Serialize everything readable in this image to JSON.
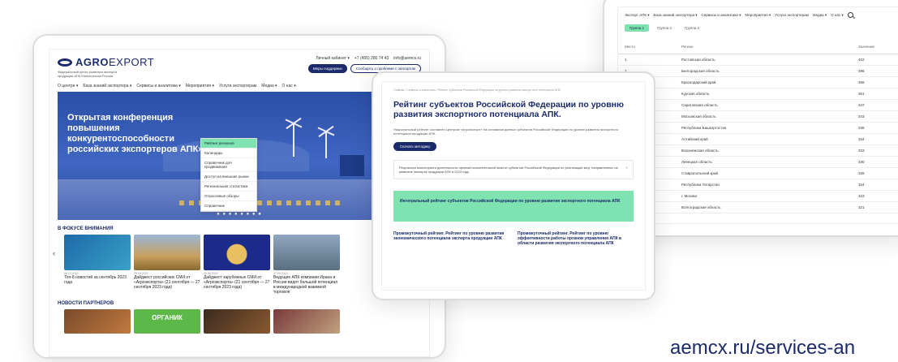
{
  "left_site": {
    "logo_bold": "AGRO",
    "logo_light": "EXPORT",
    "logo_subtitle": "Федеральный центр развития экспорта продукции АПК Минсельхоза России",
    "contacts": [
      "Личный кабинет ▾",
      "+7 (495) 280 74 43",
      "info@aemcx.ru"
    ],
    "btn_primary": "Меры поддержки",
    "btn_secondary": "Сообщить о проблеме с экспортом",
    "nav": [
      "О центре ▾",
      "База знаний экспортера ▾",
      "Сервисы и аналитика ▾",
      "Мероприятия ▾",
      "Услуги экспортерам",
      "Медиа ▾",
      "О нас ▾"
    ],
    "dropdown": [
      "Рейтинг регионов",
      "Календарь",
      "Справочник для продвижения",
      "Доступ на внешние рынки",
      "Региональная статистика",
      "Отраслевые обзоры",
      "Справочник"
    ],
    "hero_title": "Открытая конференция повышения конкурентоспособности российских экспортеров АПК»",
    "hero_dots": "● ● ● ● ● ● ● ●",
    "focus_title": "В ФОКУСЕ ВНИМАНИЯ",
    "cards": [
      {
        "date": "06.10.2023",
        "title": "Топ-8 новостей за сентябрь 2023 года"
      },
      {
        "date": "29.09.2023",
        "title": "Дайджест российских СМИ от «Агроэкспорта» (21 сентября — 27 сентября 2023 года)"
      },
      {
        "date": "29.09.2023",
        "title": "Дайджест зарубежных СМИ от «Агроэкспорта» (21 сентября — 27 сентября 2023 года)"
      },
      {
        "date": "27.09.2023",
        "title": "Ведущие АПК компании Ирана и России видят большой потенциал в международной взаимной торговле"
      }
    ],
    "partners_title": "НОВОСТИ ПАРТНЕРОВ",
    "organic_label": "ОРГАНИК"
  },
  "right_site": {
    "nav": [
      "Экспорт АПК ▾",
      "База знаний экспортера ▾",
      "Сервисы и аналитика ▾",
      "Мероприятия ▾",
      "Услуги экспортерам",
      "Медиа ▾",
      "О нас ▾"
    ],
    "tabs": [
      "Группа 1",
      "Группа 2",
      "Группа 3"
    ],
    "col_place": "Место",
    "col_region": "Регион",
    "col_value": "Значение",
    "rows": [
      [
        "1",
        "Ростовская область",
        "402"
      ],
      [
        "2",
        "Белгородская область",
        "398"
      ],
      [
        "3",
        "Краснодарский край",
        "358"
      ],
      [
        "4",
        "Курская область",
        "351"
      ],
      [
        "5",
        "Саратовская область",
        "347"
      ],
      [
        "6",
        "Московская область",
        "343"
      ],
      [
        "7",
        "Республика Башкортостан",
        "338"
      ],
      [
        "8",
        "Алтайский край",
        "334"
      ],
      [
        "9",
        "Воронежская область",
        "333"
      ],
      [
        "10",
        "Липецкая область",
        "330"
      ],
      [
        "11",
        "Ставропольский край",
        "328"
      ],
      [
        "12",
        "Республика Татарстан",
        "324"
      ],
      [
        "13",
        "г. Москва",
        "323"
      ],
      [
        "14",
        "Волгоградская область",
        "321"
      ]
    ]
  },
  "middle_site": {
    "breadcrumb": "Главная / Сервисы и аналитика / Рейтинг субъектов Российской Федерации по уровню развития экспортного потенциала АПК",
    "title": "Рейтинг субъектов Российской Федерации по уровню развития экспортного потенциала АПК.",
    "desc": "Национальный рейтинг составлен Центром «Агроэкспорт» на основании данных субъектов Российской Федерации по уровню развития экспортного потенциала продукции АПК.",
    "btn_method": "Скачать методику",
    "accordion_text": "Результаты мониторинга деятельности органов исполнительной власти субъектов Российской Федерации по реализации мер, направленных на развитие экспорта продукции АПК в 2023 году",
    "accordion_icon": "+",
    "green_box": "Интегральный рейтинг субъектов Российской Федерации по уровню развития экспортного потенциала АПК",
    "col_left": "Промежуточный рейтинг. Рейтинг по уровню развития экономического потенциала экспорта продукции АПК",
    "col_right": "Промежуточный рейтинг. Рейтинг по уровню эффективности работы органов управления АПК в области развития экспортного потенциала АПК"
  },
  "url_caption": "aemcx.ru/services-an"
}
